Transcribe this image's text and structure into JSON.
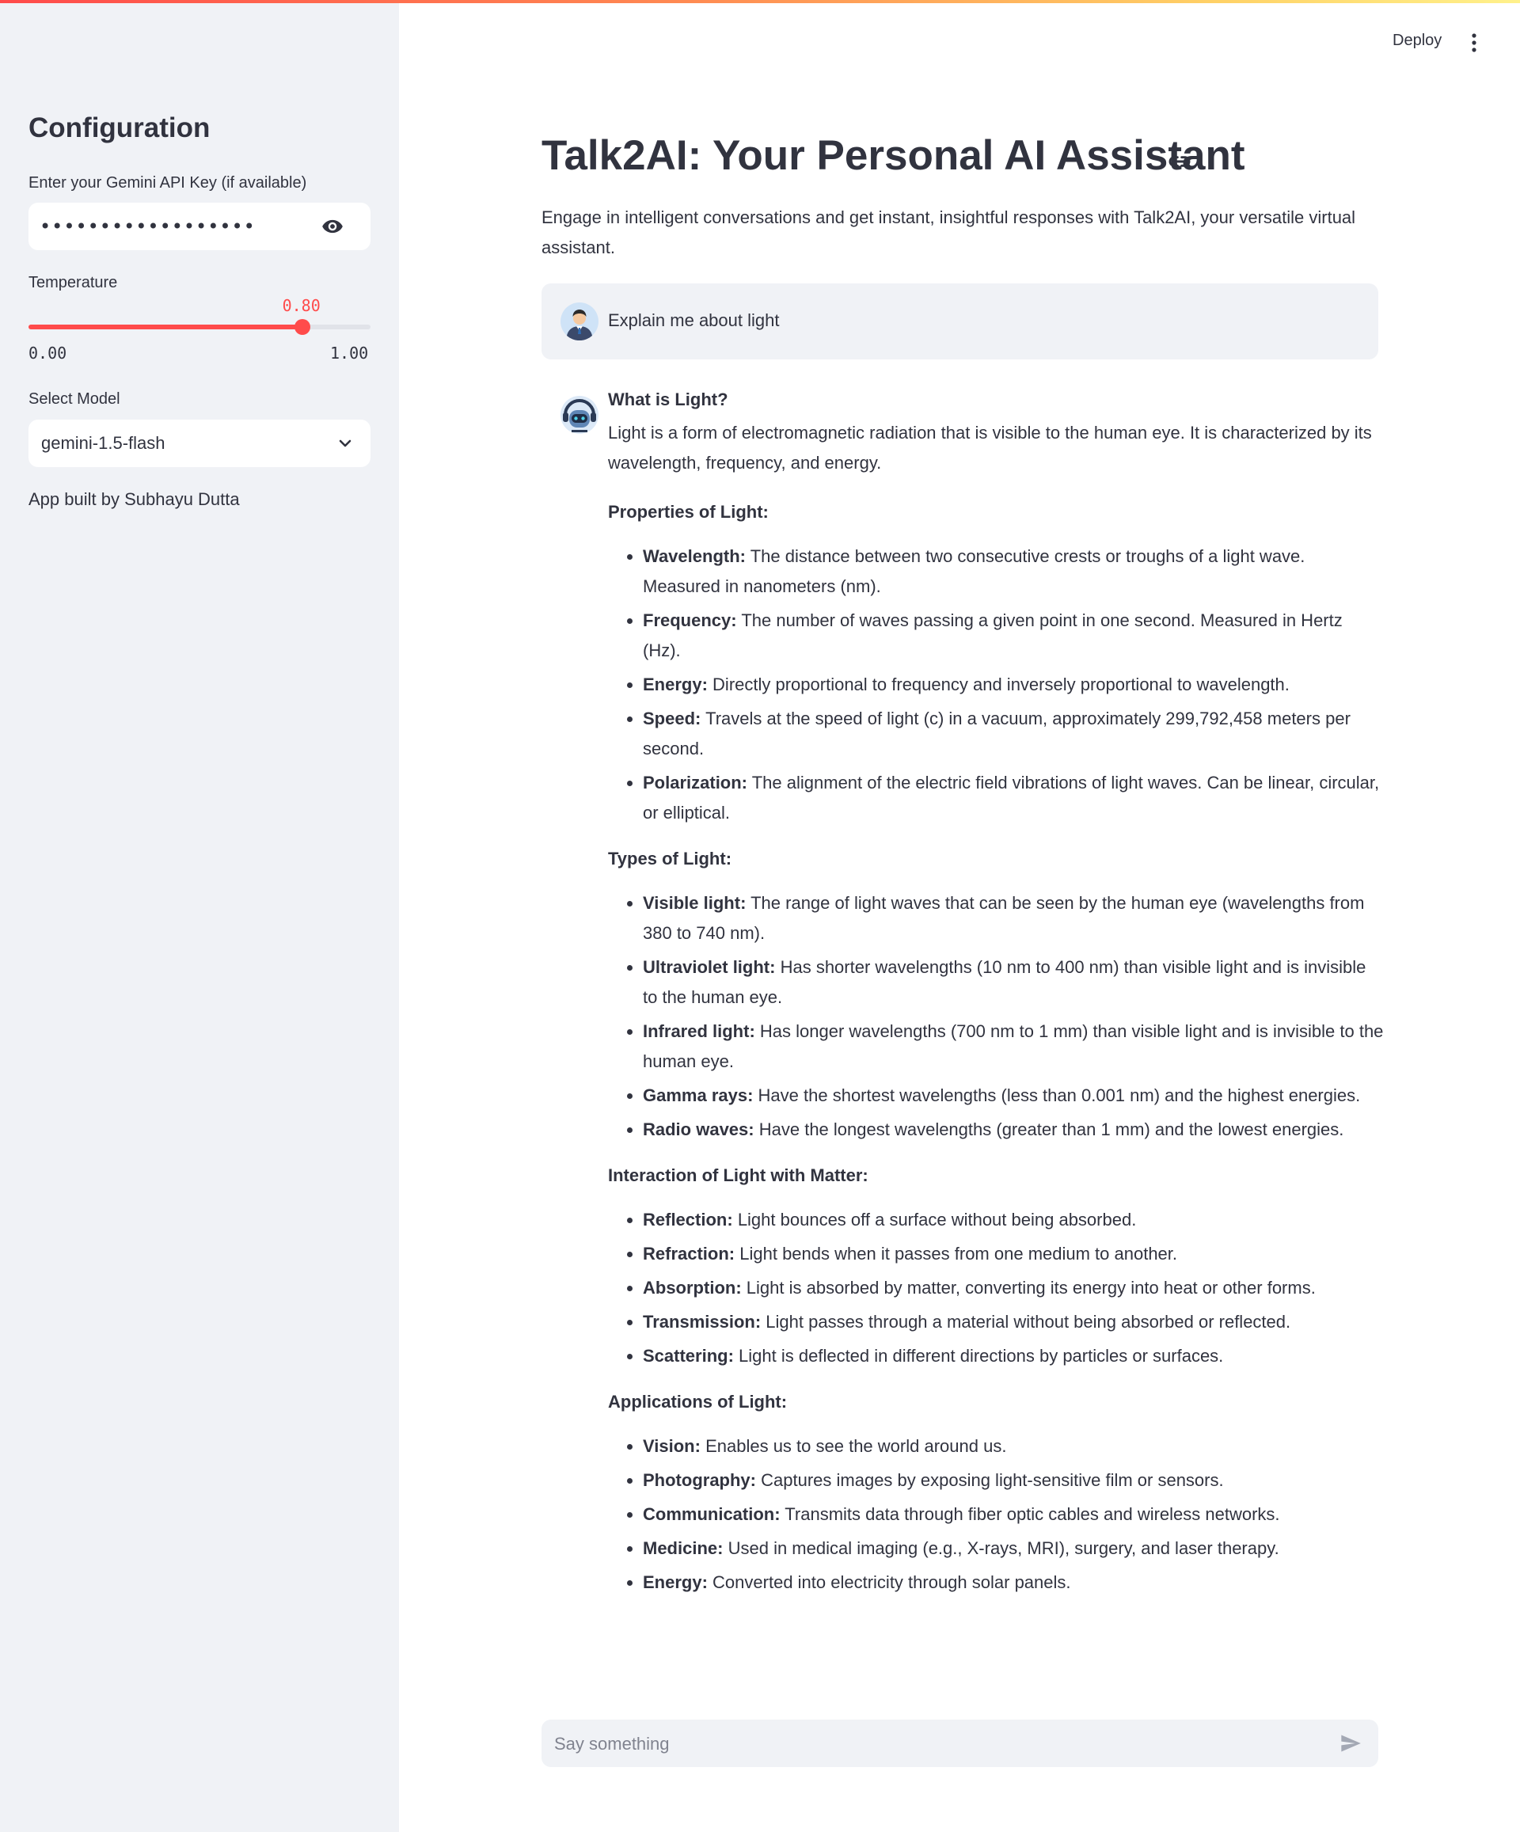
{
  "sidebar": {
    "title": "Configuration",
    "api_key": {
      "label": "Enter your Gemini API Key (if available)",
      "value": "••••••••••••••••••"
    },
    "temperature": {
      "label": "Temperature",
      "value": "0.80",
      "value_num": 0.8,
      "min": "0.00",
      "max": "1.00",
      "min_num": 0,
      "max_num": 1
    },
    "model": {
      "label": "Select Model",
      "value": "gemini-1.5-flash"
    },
    "credit": "App built by Subhayu Dutta"
  },
  "header": {
    "deploy": "Deploy"
  },
  "main": {
    "title": "Talk2AI: Your Personal AI Assistant",
    "intro": "Engage in intelligent conversations and get instant, insightful responses with Talk2AI, your versatile virtual assistant.",
    "user_message": "Explain me about light",
    "ai_response": {
      "title": "What is Light?",
      "intro": "Light is a form of electromagnetic radiation that is visible to the human eye. It is characterized by its wavelength, frequency, and energy.",
      "sections": [
        {
          "heading": "Properties of Light:",
          "items": [
            {
              "term": "Wavelength:",
              "text": "The distance between two consecutive crests or troughs of a light wave. Measured in nanometers (nm)."
            },
            {
              "term": "Frequency:",
              "text": "The number of waves passing a given point in one second. Measured in Hertz (Hz)."
            },
            {
              "term": "Energy:",
              "text": "Directly proportional to frequency and inversely proportional to wavelength."
            },
            {
              "term": "Speed:",
              "text": "Travels at the speed of light (c) in a vacuum, approximately 299,792,458 meters per second."
            },
            {
              "term": "Polarization:",
              "text": "The alignment of the electric field vibrations of light waves. Can be linear, circular, or elliptical."
            }
          ]
        },
        {
          "heading": "Types of Light:",
          "items": [
            {
              "term": "Visible light:",
              "text": "The range of light waves that can be seen by the human eye (wavelengths from 380 to 740 nm)."
            },
            {
              "term": "Ultraviolet light:",
              "text": "Has shorter wavelengths (10 nm to 400 nm) than visible light and is invisible to the human eye."
            },
            {
              "term": "Infrared light:",
              "text": "Has longer wavelengths (700 nm to 1 mm) than visible light and is invisible to the human eye."
            },
            {
              "term": "Gamma rays:",
              "text": "Have the shortest wavelengths (less than 0.001 nm) and the highest energies."
            },
            {
              "term": "Radio waves:",
              "text": "Have the longest wavelengths (greater than 1 mm) and the lowest energies."
            }
          ]
        },
        {
          "heading": "Interaction of Light with Matter:",
          "items": [
            {
              "term": "Reflection:",
              "text": "Light bounces off a surface without being absorbed."
            },
            {
              "term": "Refraction:",
              "text": "Light bends when it passes from one medium to another."
            },
            {
              "term": "Absorption:",
              "text": "Light is absorbed by matter, converting its energy into heat or other forms."
            },
            {
              "term": "Transmission:",
              "text": "Light passes through a material without being absorbed or reflected."
            },
            {
              "term": "Scattering:",
              "text": "Light is deflected in different directions by particles or surfaces."
            }
          ]
        },
        {
          "heading": "Applications of Light:",
          "items": [
            {
              "term": "Vision:",
              "text": "Enables us to see the world around us."
            },
            {
              "term": "Photography:",
              "text": "Captures images by exposing light-sensitive film or sensors."
            },
            {
              "term": "Communication:",
              "text": "Transmits data through fiber optic cables and wireless networks."
            },
            {
              "term": "Medicine:",
              "text": "Used in medical imaging (e.g., X-rays, MRI), surgery, and laser therapy."
            },
            {
              "term": "Energy:",
              "text": "Converted into electricity through solar panels."
            }
          ]
        }
      ]
    },
    "chat_input": {
      "placeholder": "Say something",
      "value": ""
    }
  },
  "icons": {
    "visibility": "eye-icon",
    "dropdown": "chevron-down-icon",
    "menu": "more-vertical-icon",
    "anchor": "link-icon",
    "send": "send-icon",
    "user_avatar": "user-avatar-icon",
    "assistant_avatar": "robot-avatar-icon"
  },
  "colors": {
    "accent": "#ff4b4b",
    "sidebar_bg": "#f0f2f6",
    "text": "#31333f"
  }
}
